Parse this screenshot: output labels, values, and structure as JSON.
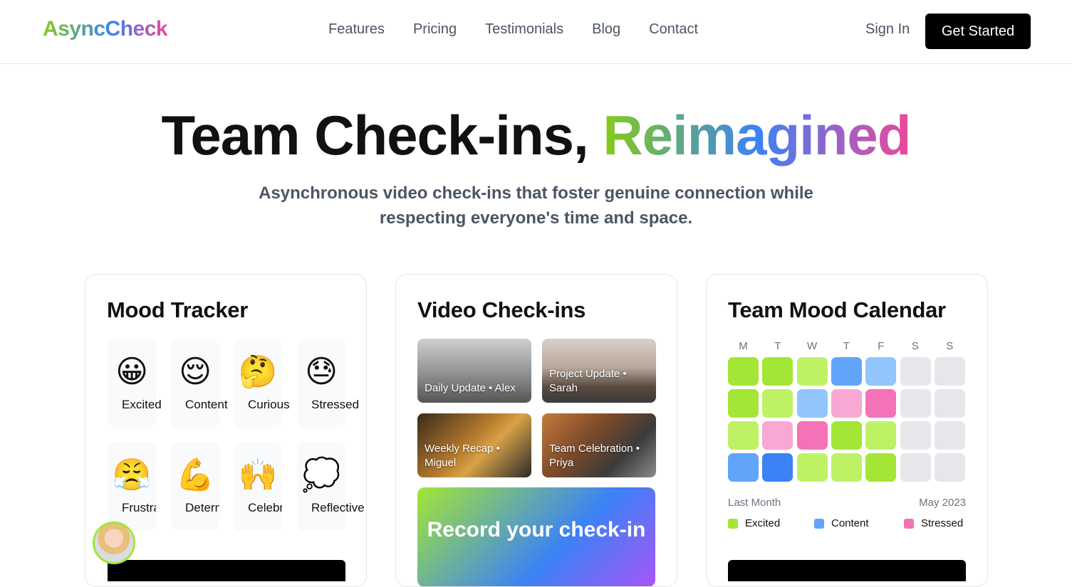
{
  "header": {
    "logo": "AsyncCheck",
    "nav": [
      "Features",
      "Pricing",
      "Testimonials",
      "Blog",
      "Contact"
    ],
    "sign_in": "Sign In",
    "get_started": "Get Started"
  },
  "hero": {
    "title_plain": "Team Check-ins, ",
    "title_gradient": "Reimagined",
    "subtitle": "Asynchronous video check-ins that foster genuine connection while respecting everyone's time and space."
  },
  "mood_tracker": {
    "title": "Mood Tracker",
    "moods": [
      {
        "emoji": "😀",
        "label": "Excited"
      },
      {
        "emoji": "😌",
        "label": "Content"
      },
      {
        "emoji": "🤔",
        "label": "Curious"
      },
      {
        "emoji": "😓",
        "label": "Stressed"
      },
      {
        "emoji": "😤",
        "label": "Frustrated"
      },
      {
        "emoji": "💪",
        "label": "Determined"
      },
      {
        "emoji": "🙌",
        "label": "Celebrating"
      },
      {
        "emoji": "💭",
        "label": "Reflective"
      }
    ]
  },
  "video_checkins": {
    "title": "Video Check-ins",
    "videos": [
      {
        "caption": "Daily Update • Alex"
      },
      {
        "caption": "Project Update • Sarah"
      },
      {
        "caption": "Weekly Recap • Miguel"
      },
      {
        "caption": "Team Celebration • Priya"
      }
    ],
    "record_label": "Record your check-in"
  },
  "calendar": {
    "title": "Team Mood Calendar",
    "days": [
      "M",
      "T",
      "W",
      "T",
      "F",
      "S",
      "S"
    ],
    "colors": {
      "excited": "#a3e635",
      "excited_light": "#bef264",
      "content": "#60a5fa",
      "content_light": "#93c5fd",
      "content_dark": "#3b82f6",
      "stressed": "#f472b6",
      "stressed_light": "#f9a8d4",
      "empty": "#e5e7eb"
    },
    "grid": [
      [
        "excited",
        "excited",
        "excited_light",
        "content",
        "content_light",
        "empty",
        "empty"
      ],
      [
        "excited",
        "excited_light",
        "content_light",
        "stressed_light",
        "stressed",
        "empty",
        "empty"
      ],
      [
        "excited_light",
        "stressed_light",
        "stressed",
        "excited",
        "excited_light",
        "empty",
        "empty"
      ],
      [
        "content",
        "content_dark",
        "excited_light",
        "excited_light",
        "excited",
        "empty",
        "empty"
      ]
    ],
    "footer_left": "Last Month",
    "footer_right": "May 2023",
    "legend": [
      {
        "label": "Excited",
        "color": "#a3e635"
      },
      {
        "label": "Content",
        "color": "#60a5fa"
      },
      {
        "label": "Stressed",
        "color": "#f472b6"
      }
    ]
  }
}
